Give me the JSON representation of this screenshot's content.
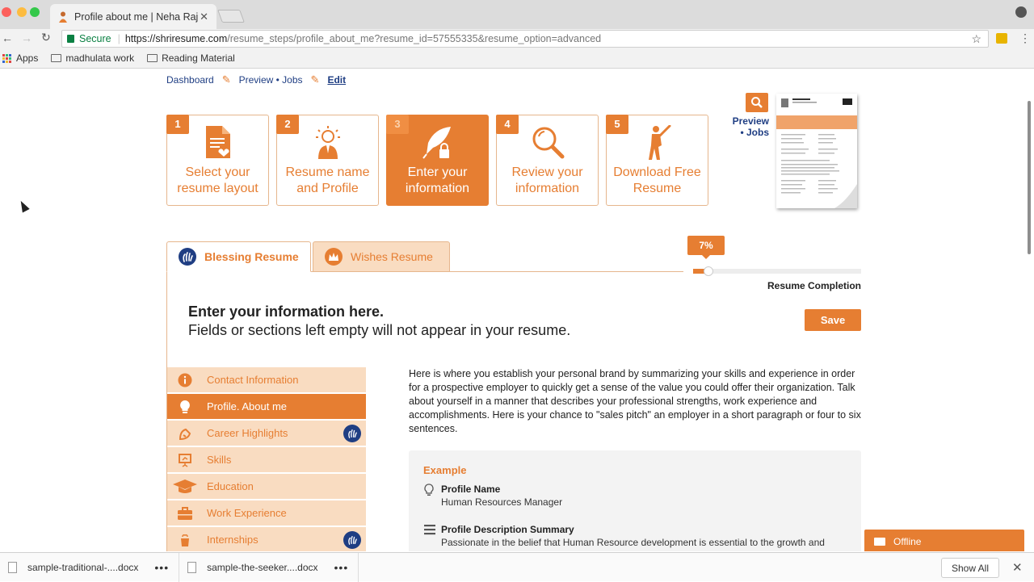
{
  "browser": {
    "tab_title": "Profile about me | Neha Raj",
    "tab_close": "✕",
    "secure_label": "Secure",
    "url_host": "https://shriresume.com",
    "url_path": "/resume_steps/profile_about_me?resume_id=57555335&resume_option=advanced",
    "bookmarks": [
      "Apps",
      "madhulata work",
      "Reading Material"
    ]
  },
  "breadcrumbs": {
    "dashboard": "Dashboard",
    "preview_jobs": "Preview • Jobs",
    "edit": "Edit"
  },
  "steps": [
    {
      "num": "1",
      "label": "Select your resume layout",
      "icon": "document-heart-icon"
    },
    {
      "num": "2",
      "label": "Resume name and Profile",
      "icon": "lightbulb-person-icon"
    },
    {
      "num": "3",
      "label": "Enter your information",
      "icon": "quill-icon"
    },
    {
      "num": "4",
      "label": "Review your information",
      "icon": "magnifier-icon"
    },
    {
      "num": "5",
      "label": "Download Free Resume",
      "icon": "cricket-player-icon"
    }
  ],
  "preview": {
    "line1": "Preview",
    "line2": "• Jobs"
  },
  "resume_tabs": {
    "active": "Blessing Resume",
    "inactive": "Wishes Resume"
  },
  "progress": {
    "percent_label": "7%",
    "value": 0.07,
    "label": "Resume Completion"
  },
  "info": {
    "heading": "Enter your information here.",
    "subheading": "Fields or sections left empty will not appear in your resume.",
    "save_label": "Save"
  },
  "sidenav": [
    {
      "label": "Contact Information",
      "icon": "info-circle-icon",
      "active": false,
      "badge": false
    },
    {
      "label": "Profile. About me",
      "icon": "lightbulb-icon",
      "active": true,
      "badge": false
    },
    {
      "label": "Career Highlights",
      "icon": "highlight-icon",
      "active": false,
      "badge": true
    },
    {
      "label": "Skills",
      "icon": "presentation-icon",
      "active": false,
      "badge": false
    },
    {
      "label": "Education",
      "icon": "graduation-cap-icon",
      "active": false,
      "badge": false
    },
    {
      "label": "Work Experience",
      "icon": "briefcase-icon",
      "active": false,
      "badge": false
    },
    {
      "label": "Internships",
      "icon": "cup-icon",
      "active": false,
      "badge": true
    }
  ],
  "description": "Here is where you establish your personal brand by summarizing your skills and experience in order for a prospective employer to quickly get a sense of the value you could offer their organization. Talk about yourself in a manner that describes your professional strengths, work experience and accomplishments. Here is your chance to \"sales pitch\" an employer in a short paragraph or four to six sentences.",
  "example": {
    "title": "Example",
    "profile_name_label": "Profile Name",
    "profile_name_value": "Human Resources Manager",
    "summary_label": "Profile Description Summary",
    "summary_value": "Passionate in the belief that Human Resource development is essential to the growth and"
  },
  "chat": {
    "status": "Offline"
  },
  "downloads": {
    "files": [
      "sample-traditional-....docx",
      "sample-the-seeker....docx"
    ],
    "more": "•••",
    "show_all": "Show All",
    "close": "✕"
  },
  "colors": {
    "accent": "#e67e32",
    "accent_light": "#f9dcc1",
    "navy": "#1f3e83"
  }
}
